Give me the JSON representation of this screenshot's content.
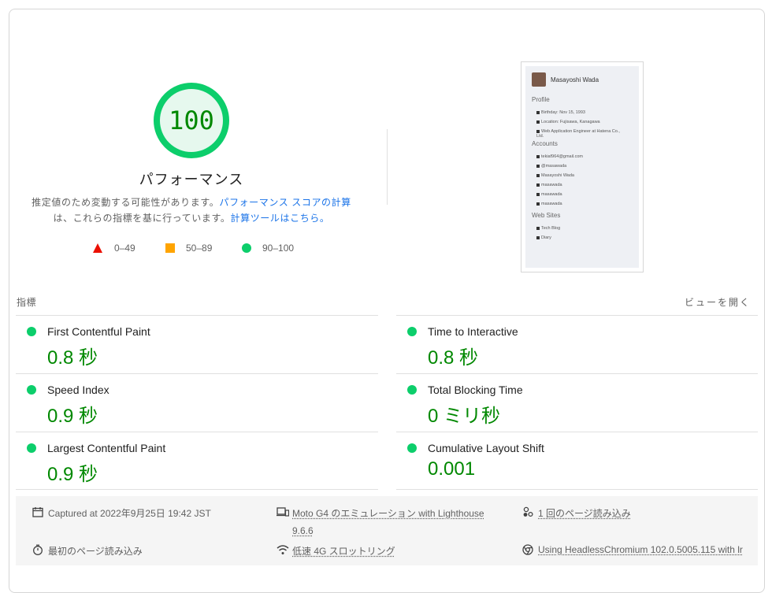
{
  "score": {
    "value": "100",
    "title": "パフォーマンス",
    "desc_text": "推定値のため変動する可能性があります。",
    "desc_link1": "パフォーマンス スコアの計算",
    "desc_text2": "は、これらの指標を基に行っています。",
    "desc_link2": "計算ツールはこちら。",
    "ring_color": "#0cce6b",
    "value_color": "#008800"
  },
  "legend": [
    {
      "label": "0–49",
      "shape": "triangle",
      "color": "#eb0f00"
    },
    {
      "label": "50–89",
      "shape": "square",
      "color": "#ffa400"
    },
    {
      "label": "90–100",
      "shape": "circle",
      "color": "#0cce6b"
    }
  ],
  "screenshot": {
    "name": "Masayoshi Wada",
    "sections": [
      {
        "heading": "Profile",
        "rows": [
          "Birthday: Nov 15, 1993",
          "Location: Fujisawa, Kanagawa",
          "Web Application Engineer at Hatena Co., Ltd."
        ]
      },
      {
        "heading": "Accounts",
        "rows": [
          "tekiaf964@gmail.com",
          "@masawada",
          "Masayoshi Wada",
          "masawada",
          "masawada",
          "masawada"
        ]
      },
      {
        "heading": "Web Sites",
        "rows": [
          "Tech Blog",
          "Diary"
        ]
      }
    ]
  },
  "metrics_header": {
    "label": "指標",
    "toggle": "ビューを開く"
  },
  "metrics": [
    {
      "name": "First Contentful Paint",
      "value": "0.8 秒"
    },
    {
      "name": "Time to Interactive",
      "value": "0.8 秒"
    },
    {
      "name": "Speed Index",
      "value": "0.9 秒"
    },
    {
      "name": "Total Blocking Time",
      "value": "0 ミリ秒"
    },
    {
      "name": "Largest Contentful Paint",
      "value": "0.9 秒"
    },
    {
      "name": "Cumulative Layout Shift",
      "value": "0.001"
    }
  ],
  "footer": {
    "captured": "Captured at 2022年9月25日 19:42 JST",
    "device": "Moto G4 のエミュレーション with Lighthouse",
    "device_version": "9.6.6",
    "page_loads": "1 回のページ読み込み",
    "initial_load": "最初のページ読み込み",
    "throttling": "低速 4G スロットリング",
    "browser": "Using HeadlessChromium 102.0.5005.115 with lr"
  }
}
